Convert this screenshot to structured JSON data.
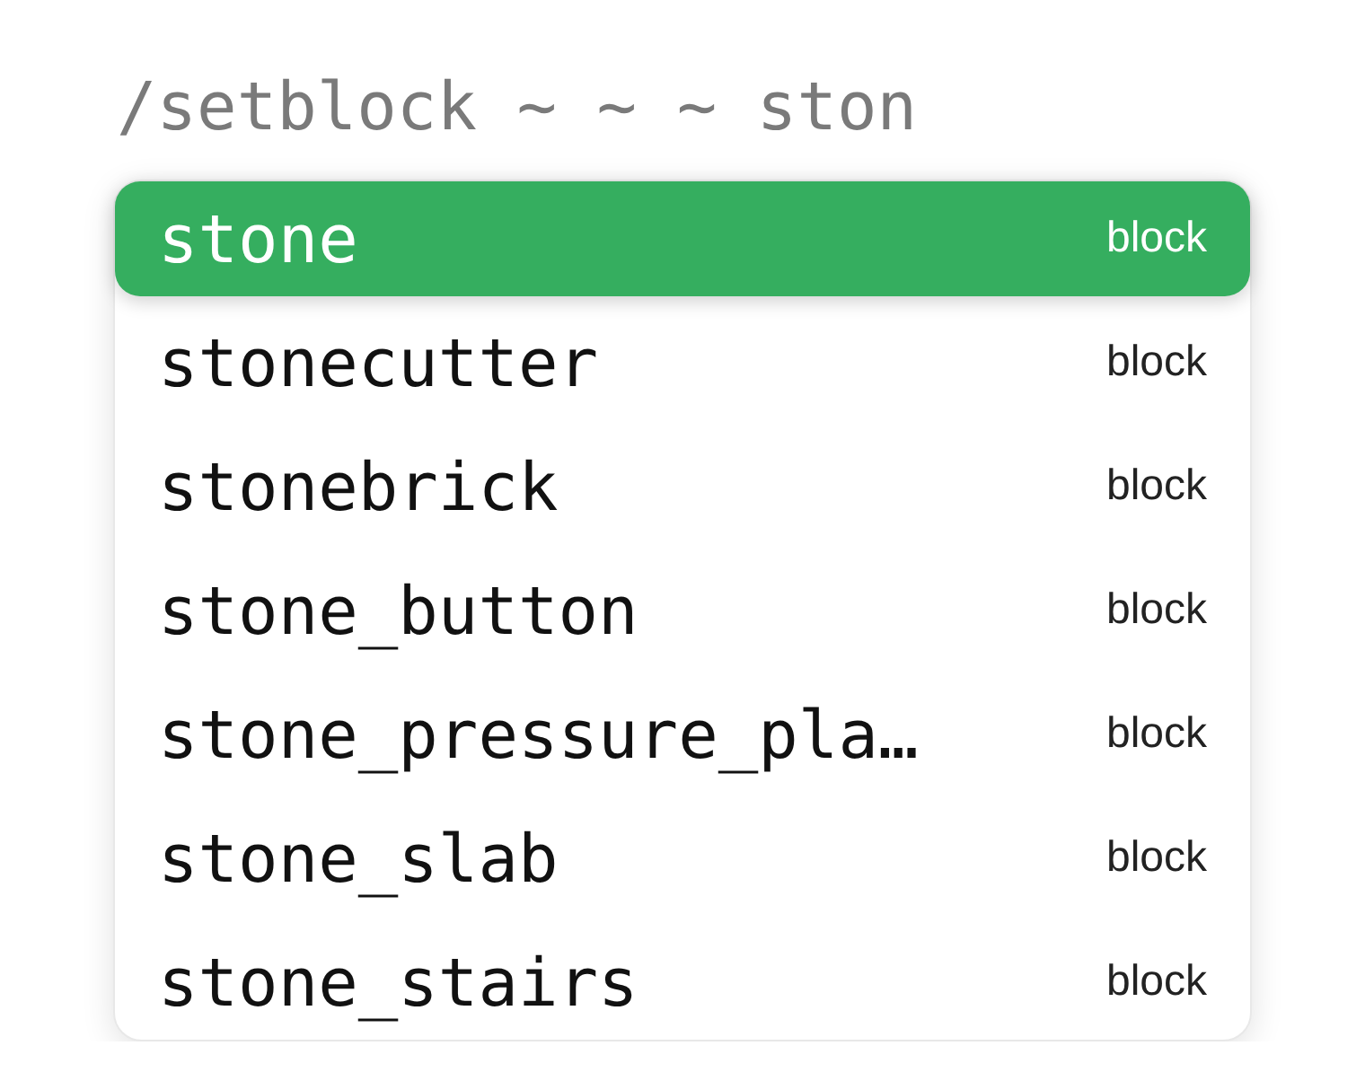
{
  "command": {
    "value": "/setblock ~ ~ ~ ston"
  },
  "suggestions": [
    {
      "name": "stone",
      "tag": "block",
      "selected": true
    },
    {
      "name": "stonecutter",
      "tag": "block",
      "selected": false
    },
    {
      "name": "stonebrick",
      "tag": "block",
      "selected": false
    },
    {
      "name": "stone_button",
      "tag": "block",
      "selected": false
    },
    {
      "name": "stone_pressure_pla…",
      "tag": "block",
      "selected": false
    },
    {
      "name": "stone_slab",
      "tag": "block",
      "selected": false
    },
    {
      "name": "stone_stairs",
      "tag": "block",
      "selected": false
    }
  ]
}
